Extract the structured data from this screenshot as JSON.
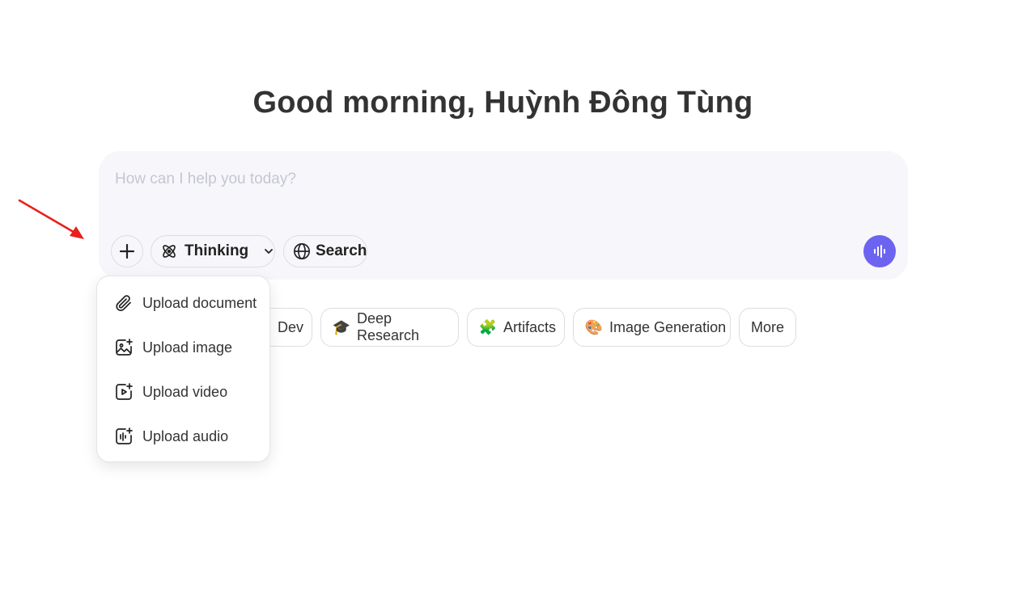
{
  "greeting": "Good morning, Huỳnh Đông Tùng",
  "composer": {
    "placeholder": "How can I help you today?",
    "thinking_label": "Thinking",
    "search_label": "Search"
  },
  "chips": [
    {
      "label": "Dev",
      "emoji": ""
    },
    {
      "label": "Deep Research",
      "emoji": "🎓"
    },
    {
      "label": "Artifacts",
      "emoji": "🧩"
    },
    {
      "label": "Image Generation",
      "emoji": "🎨"
    },
    {
      "label": "More",
      "emoji": ""
    }
  ],
  "upload_menu": {
    "items": [
      {
        "label": "Upload document",
        "icon": "paperclip-icon"
      },
      {
        "label": "Upload image",
        "icon": "image-upload-icon"
      },
      {
        "label": "Upload video",
        "icon": "video-upload-icon"
      },
      {
        "label": "Upload audio",
        "icon": "audio-upload-icon"
      }
    ]
  },
  "colors": {
    "accent": "#6c63f0",
    "composer_bg": "#f7f7fb",
    "annotation_arrow": "#e8211d"
  }
}
